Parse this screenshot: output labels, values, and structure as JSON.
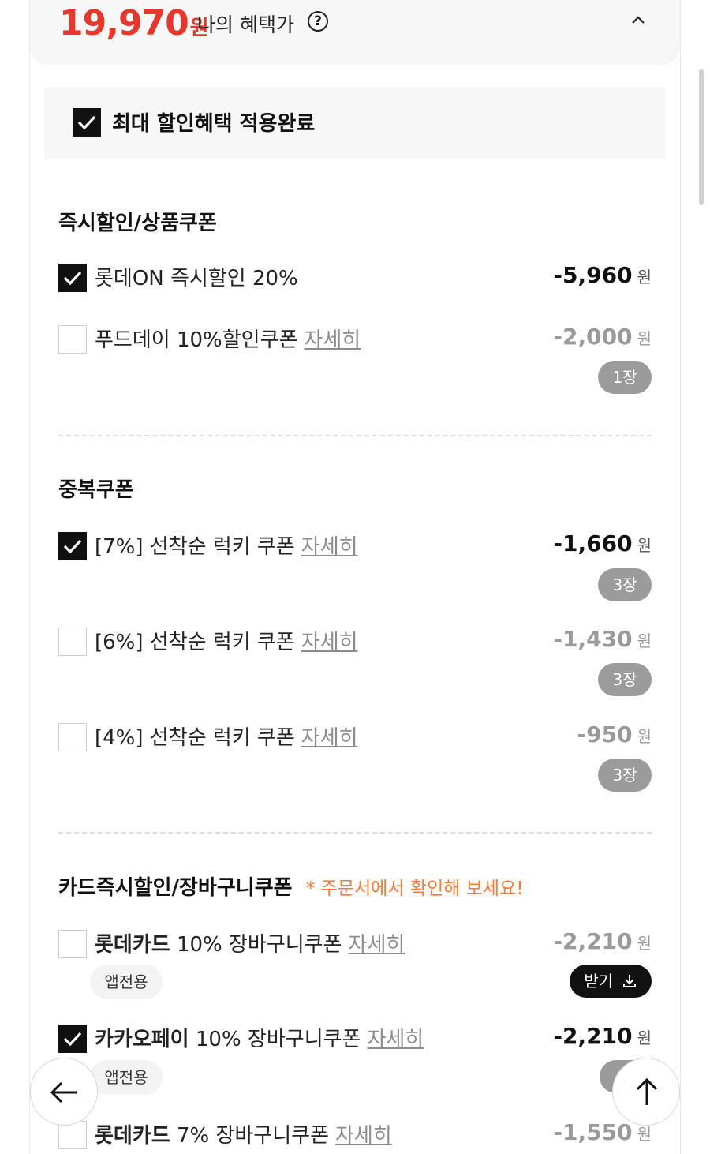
{
  "header": {
    "price": "19,970",
    "currency": "원",
    "label": "나의 혜택가",
    "help_glyph": "?"
  },
  "banner": {
    "label": "최대 할인혜택 적용완료",
    "checked": true
  },
  "sections": [
    {
      "title": "즉시할인/상품쿠폰",
      "items": [
        {
          "label": "롯데ON 즉시할인 20%",
          "amount": "-5,960",
          "unit": "원",
          "checked": true
        },
        {
          "label": "푸드데이 10%할인쿠폰",
          "detail": "자세히",
          "amount": "-2,000",
          "unit": "원",
          "count": "1장",
          "checked": false
        }
      ]
    },
    {
      "title": "중복쿠폰",
      "items": [
        {
          "label": "[7%] 선착순 럭키 쿠폰",
          "detail": "자세히",
          "amount": "-1,660",
          "unit": "원",
          "count": "3장",
          "checked": true
        },
        {
          "label": "[6%] 선착순 럭키 쿠폰",
          "detail": "자세히",
          "amount": "-1,430",
          "unit": "원",
          "count": "3장",
          "checked": false
        },
        {
          "label": "[4%] 선착순 럭키 쿠폰",
          "detail": "자세히",
          "amount": "-950",
          "unit": "원",
          "count": "3장",
          "checked": false
        }
      ]
    },
    {
      "title": "카드즉시할인/장바구니쿠폰",
      "note": "* 주문서에서 확인해 보세요!",
      "items": [
        {
          "label_bold": "롯데카드",
          "label_rest": " 10% 장바구니쿠폰",
          "detail": "자세히",
          "amount": "-2,210",
          "unit": "원",
          "tag": "앱전용",
          "action": "받기",
          "checked": false
        },
        {
          "label_bold": "카카오페이",
          "label_rest": " 10% 장바구니쿠폰",
          "detail": "자세히",
          "amount": "-2,210",
          "unit": "원",
          "tag": "앱전용",
          "checked": true
        },
        {
          "label_bold": "롯데카드",
          "label_rest": " 7% 장바구니쿠폰",
          "detail": "자세히",
          "amount": "-1,550",
          "unit": "원",
          "checked": false
        }
      ]
    }
  ],
  "colors": {
    "price_red": "#e8362b",
    "note_orange": "#ff7a2f",
    "pill_gray": "#9b9b9b"
  },
  "icons": {
    "chevron": "chevron-up-icon",
    "back": "arrow-left-icon",
    "top": "arrow-up-icon",
    "download": "download-icon"
  }
}
